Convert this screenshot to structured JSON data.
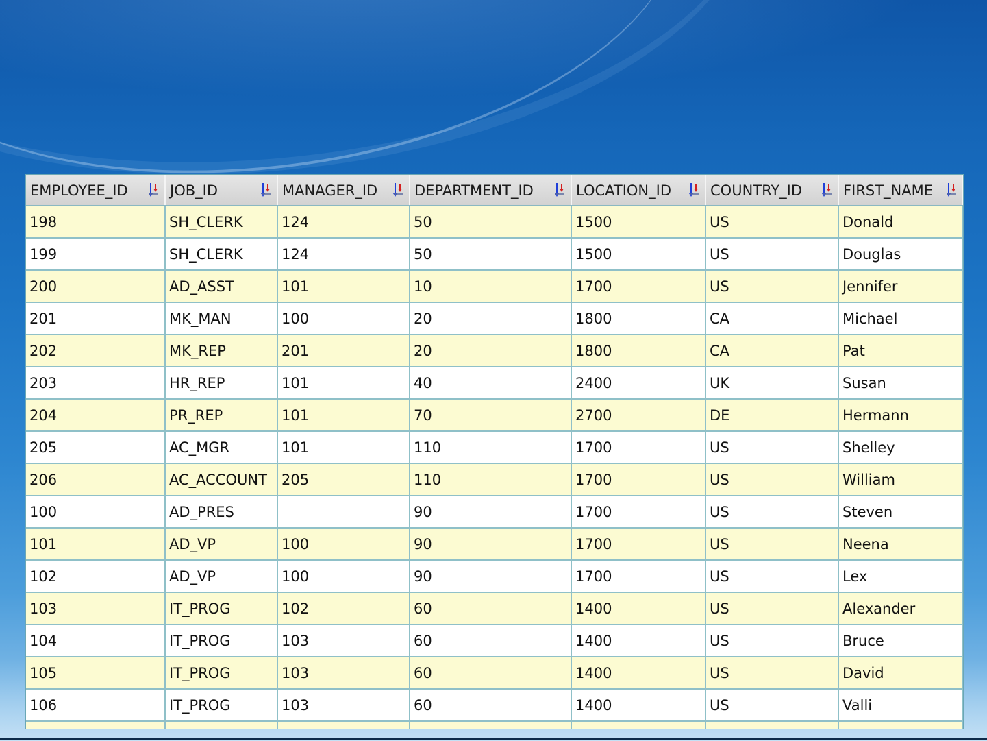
{
  "grid": {
    "columns": [
      {
        "key": "employee_id",
        "label": "EMPLOYEE_ID"
      },
      {
        "key": "job_id",
        "label": "JOB_ID"
      },
      {
        "key": "manager_id",
        "label": "MANAGER_ID"
      },
      {
        "key": "department_id",
        "label": "DEPARTMENT_ID"
      },
      {
        "key": "location_id",
        "label": "LOCATION_ID"
      },
      {
        "key": "country_id",
        "label": "COUNTRY_ID"
      },
      {
        "key": "first_name",
        "label": "FIRST_NAME"
      }
    ],
    "sort_icon": "sort-arrows-icon",
    "rows": [
      [
        "198",
        "SH_CLERK",
        "124",
        "50",
        "1500",
        "US",
        "Donald"
      ],
      [
        "199",
        "SH_CLERK",
        "124",
        "50",
        "1500",
        "US",
        "Douglas"
      ],
      [
        "200",
        "AD_ASST",
        "101",
        "10",
        "1700",
        "US",
        "Jennifer"
      ],
      [
        "201",
        "MK_MAN",
        "100",
        "20",
        "1800",
        "CA",
        "Michael"
      ],
      [
        "202",
        "MK_REP",
        "201",
        "20",
        "1800",
        "CA",
        "Pat"
      ],
      [
        "203",
        "HR_REP",
        "101",
        "40",
        "2400",
        "UK",
        "Susan"
      ],
      [
        "204",
        "PR_REP",
        "101",
        "70",
        "2700",
        "DE",
        "Hermann"
      ],
      [
        "205",
        "AC_MGR",
        "101",
        "110",
        "1700",
        "US",
        "Shelley"
      ],
      [
        "206",
        "AC_ACCOUNT",
        "205",
        "110",
        "1700",
        "US",
        "William"
      ],
      [
        "100",
        "AD_PRES",
        "",
        "90",
        "1700",
        "US",
        "Steven"
      ],
      [
        "101",
        "AD_VP",
        "100",
        "90",
        "1700",
        "US",
        "Neena"
      ],
      [
        "102",
        "AD_VP",
        "100",
        "90",
        "1700",
        "US",
        "Lex"
      ],
      [
        "103",
        "IT_PROG",
        "102",
        "60",
        "1400",
        "US",
        "Alexander"
      ],
      [
        "104",
        "IT_PROG",
        "103",
        "60",
        "1400",
        "US",
        "Bruce"
      ],
      [
        "105",
        "IT_PROG",
        "103",
        "60",
        "1400",
        "US",
        "David"
      ],
      [
        "106",
        "IT_PROG",
        "103",
        "60",
        "1400",
        "US",
        "Valli"
      ]
    ],
    "colors": {
      "odd_row": "#fcfbd2",
      "even_row": "#ffffff",
      "grid_line": "#8fc0c8",
      "header_bg": "#d8d8d8",
      "sort_up": "#d42020",
      "sort_down": "#1f3fd8"
    }
  }
}
